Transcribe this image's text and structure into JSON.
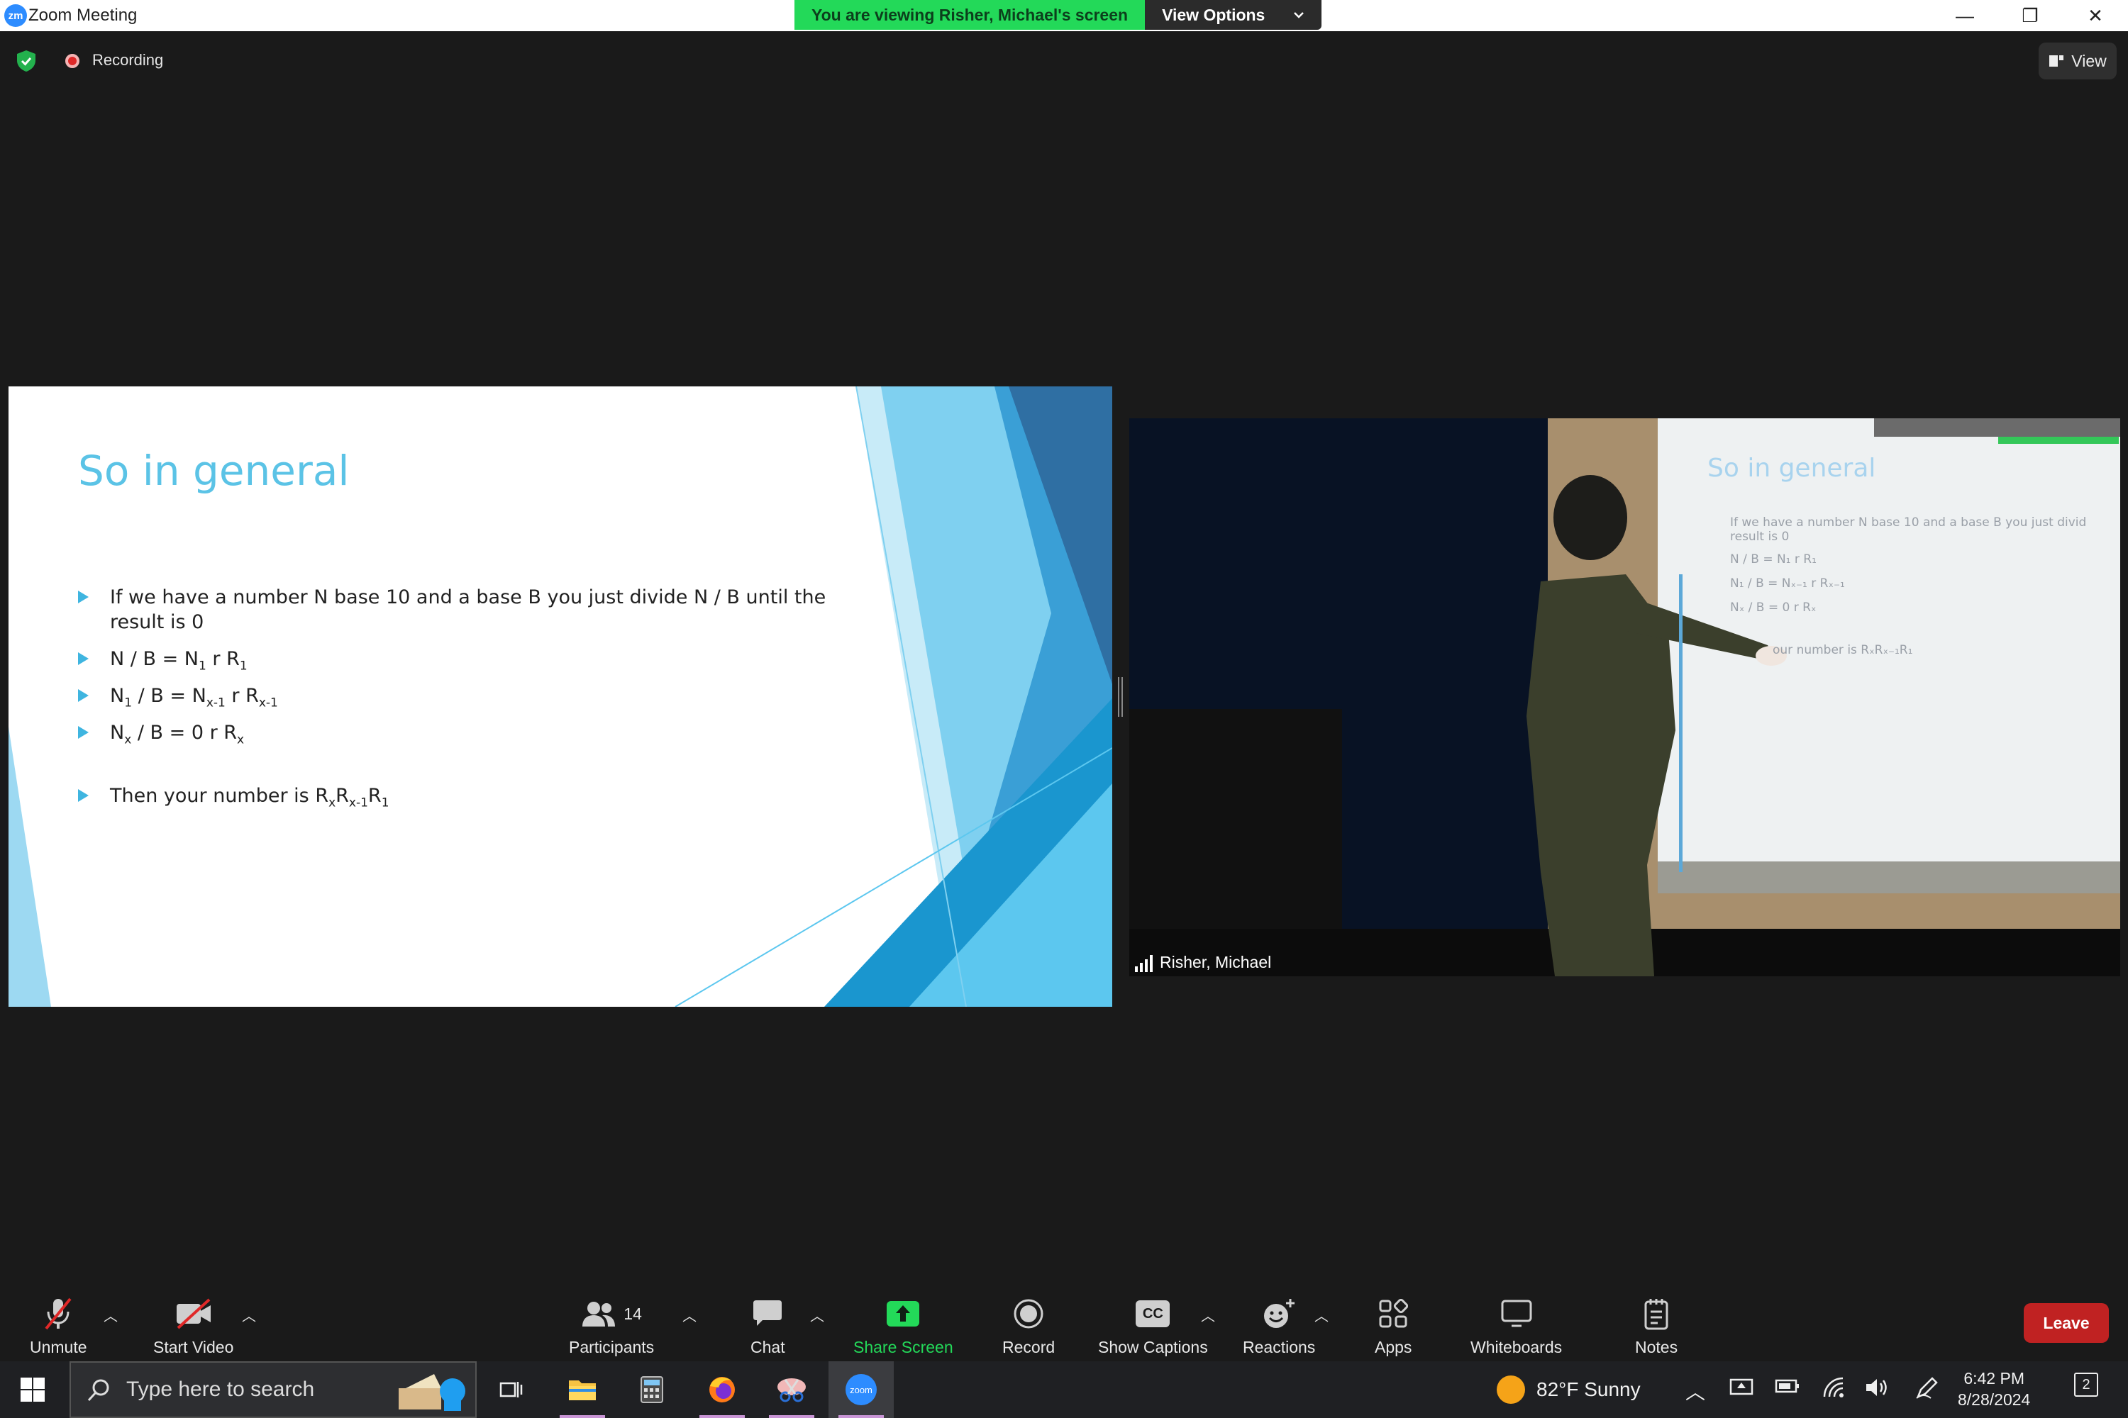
{
  "window": {
    "app_icon": "zm",
    "title": "Zoom Meeting",
    "controls": {
      "minimize": "—",
      "restore": "❐",
      "close": "✕"
    }
  },
  "share_banner": {
    "status": "You are viewing Risher, Michael's screen",
    "view_options": "View Options"
  },
  "top_bar": {
    "recording_label": "Recording",
    "view_label": "View"
  },
  "slide": {
    "title": "So in general",
    "bullets": [
      {
        "text": "If we have a number N base 10 and a base B you just divide N / B until the result is 0"
      }
    ],
    "eq1": {
      "a": "N / B = N",
      "a_sub": "1",
      "b": " r R",
      "b_sub": "1"
    },
    "eq2": {
      "a": "N",
      "a_sub": "1",
      "b": " / B = N",
      "b_sub": "x-1",
      "c": " r R",
      "c_sub": "x-1"
    },
    "eq3": {
      "a": "N",
      "a_sub": "x",
      "b": " / B = 0 r R",
      "b_sub": "x"
    },
    "conclusion": {
      "a": "Then your number is R",
      "a_sub": "x",
      "b": "R",
      "b_sub": "x-1",
      "c": "R",
      "c_sub": "1"
    },
    "colors": {
      "title": "#5bc3e6",
      "bullet": "#3fb5e0"
    }
  },
  "video": {
    "participant_name": "Risher, Michael",
    "projected_title": "So in general",
    "projected_lines": [
      "If we have a number N base 10 and a base B you just divid",
      "result is 0",
      "N / B = N₁ r R₁",
      "N₁ / B = Nₓ₋₁ r Rₓ₋₁",
      "Nₓ / B = 0 r Rₓ",
      "our number is RₓRₓ₋₁R₁"
    ]
  },
  "toolbar": {
    "unmute": "Unmute",
    "start_video": "Start Video",
    "participants": "Participants",
    "participants_count": "14",
    "chat": "Chat",
    "share_screen": "Share Screen",
    "record": "Record",
    "show_captions": "Show Captions",
    "captions_icon_text": "CC",
    "reactions": "Reactions",
    "apps": "Apps",
    "whiteboards": "Whiteboards",
    "notes": "Notes",
    "leave": "Leave",
    "colors": {
      "share": "#23d959",
      "leave": "#c02222"
    }
  },
  "taskbar": {
    "search_placeholder": "Type here to search",
    "weather": "82°F  Sunny",
    "time": "6:42 PM",
    "date": "8/28/2024",
    "notification_count": "2",
    "zoom_icon_text": "zoom"
  }
}
